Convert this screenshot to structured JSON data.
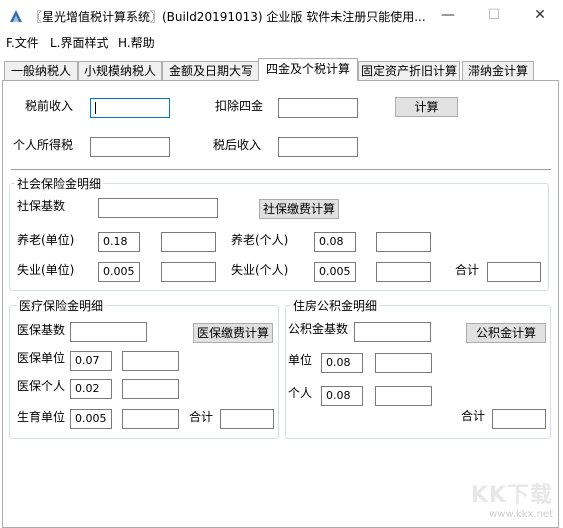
{
  "window": {
    "title": "〖星光增值税计算系统〗(Build20191013) 企业版 软件未注册只能使用...",
    "minimize": "—",
    "maximize": "☐",
    "close": "✕"
  },
  "menu": [
    "F.文件",
    "L.界面样式",
    "H.帮助"
  ],
  "tabs": [
    "一般纳税人",
    "小规模纳税人",
    "金额及日期大写",
    "四金及个税计算",
    "固定资产折旧计算",
    "滞纳金计算"
  ],
  "active_tab": 3,
  "top": {
    "pretax_label": "税前收入",
    "deduct_label": "扣除四金",
    "calc_button": "计算",
    "tax_label": "个人所得税",
    "aftertax_label": "税后收入"
  },
  "social": {
    "title": "社会保险金明细",
    "base_label": "社保基数",
    "calc_button": "社保缴费计算",
    "pension_unit_label": "养老(单位)",
    "pension_unit_rate": "0.18",
    "pension_person_label": "养老(个人)",
    "pension_person_rate": "0.08",
    "unemp_unit_label": "失业(单位)",
    "unemp_unit_rate": "0.005",
    "unemp_person_label": "失业(个人)",
    "unemp_person_rate": "0.005",
    "total_label": "合计"
  },
  "medical": {
    "title": "医疗保险金明细",
    "base_label": "医保基数",
    "calc_button": "医保缴费计算",
    "unit_label": "医保单位",
    "unit_rate": "0.07",
    "person_label": "医保个人",
    "person_rate": "0.02",
    "birth_label": "生育单位",
    "birth_rate": "0.005",
    "total_label": "合计"
  },
  "housing": {
    "title": "住房公积金明细",
    "base_label": "公积金基数",
    "calc_button": "公积金计算",
    "unit_label": "单位",
    "unit_rate": "0.08",
    "person_label": "个人",
    "person_rate": "0.08",
    "total_label": "合计"
  },
  "watermark": {
    "logo": "KK下载",
    "url": "www.kkx.net"
  }
}
